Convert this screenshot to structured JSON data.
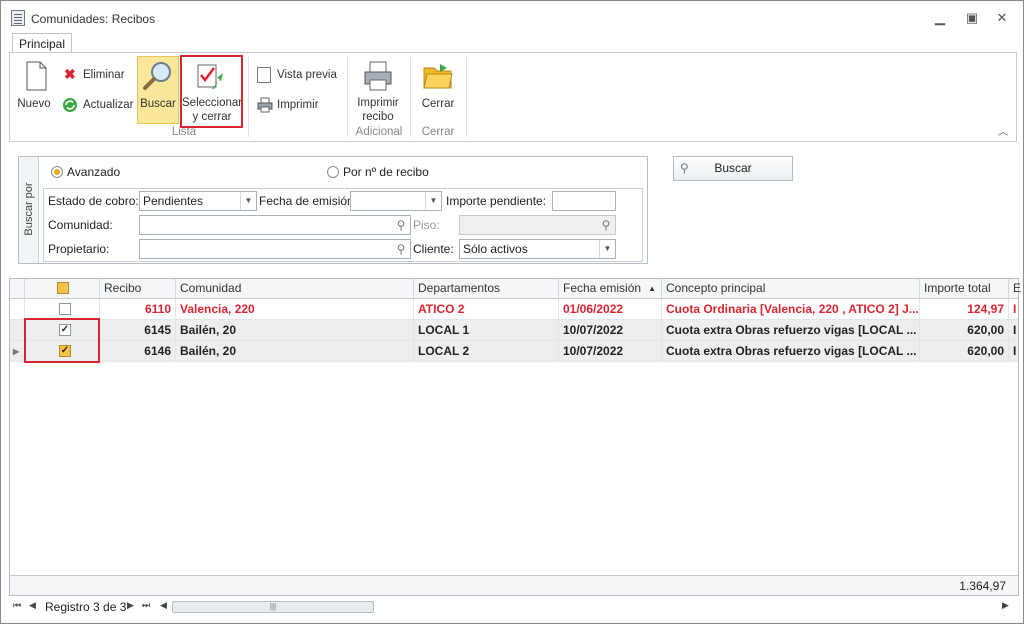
{
  "window": {
    "title": "Comunidades: Recibos"
  },
  "tabs": [
    {
      "label": "Principal"
    }
  ],
  "ribbon": {
    "nuevo": "Nuevo",
    "eliminar": "Eliminar",
    "actualizar": "Actualizar",
    "buscar": "Buscar",
    "seleccionar_1": "Seleccionar",
    "seleccionar_2": "y cerrar",
    "vista_previa": "Vista previa",
    "imprimir": "Imprimir",
    "imprimir_recibo_1": "Imprimir",
    "imprimir_recibo_2": "recibo",
    "cerrar": "Cerrar",
    "groups": {
      "lista": "Lista",
      "adicional": "Adicional",
      "cerrar": "Cerrar"
    }
  },
  "filter": {
    "side_label": "Buscar por",
    "radio_avanzado": "Avanzado",
    "radio_recibo": "Por nº de recibo",
    "estado_label": "Estado de cobro:",
    "estado_value": "Pendientes",
    "fecha_label": "Fecha de emisión:",
    "fecha_value": "",
    "importe_label": "Importe pendiente:",
    "importe_value": "",
    "comunidad_label": "Comunidad:",
    "comunidad_value": "",
    "piso_label": "Piso:",
    "piso_value": "",
    "propietario_label": "Propietario:",
    "propietario_value": "",
    "cliente_label": "Cliente:",
    "cliente_value": "Sólo activos",
    "buscar_button": "Buscar"
  },
  "grid": {
    "columns": [
      "Recibo",
      "Comunidad",
      "Departamentos",
      "Fecha emisión",
      "Concepto principal",
      "Importe total",
      "E"
    ],
    "rows": [
      {
        "recibo": "6110",
        "comunidad": "Valencia, 220",
        "departamento": "ATICO 2",
        "fecha": "01/06/2022",
        "concepto": "Cuota Ordinaria [Valencia, 220 , ATICO 2] J...",
        "importe": "124,97",
        "checked": false,
        "red": true
      },
      {
        "recibo": "6145",
        "comunidad": "Bailén, 20",
        "departamento": "LOCAL 1",
        "fecha": "10/07/2022",
        "concepto": "Cuota extra Obras refuerzo vigas [LOCAL ...",
        "importe": "620,00",
        "checked": true,
        "red": false
      },
      {
        "recibo": "6146",
        "comunidad": "Bailén, 20",
        "departamento": "LOCAL 2",
        "fecha": "10/07/2022",
        "concepto": "Cuota extra Obras refuerzo vigas [LOCAL ...",
        "importe": "620,00",
        "checked": true,
        "red": false
      }
    ],
    "total": "1.364,97",
    "navigator": "Registro 3 de 3"
  },
  "colors": {
    "accent_red": "#d9252f",
    "highlight": "#fbe79a"
  }
}
